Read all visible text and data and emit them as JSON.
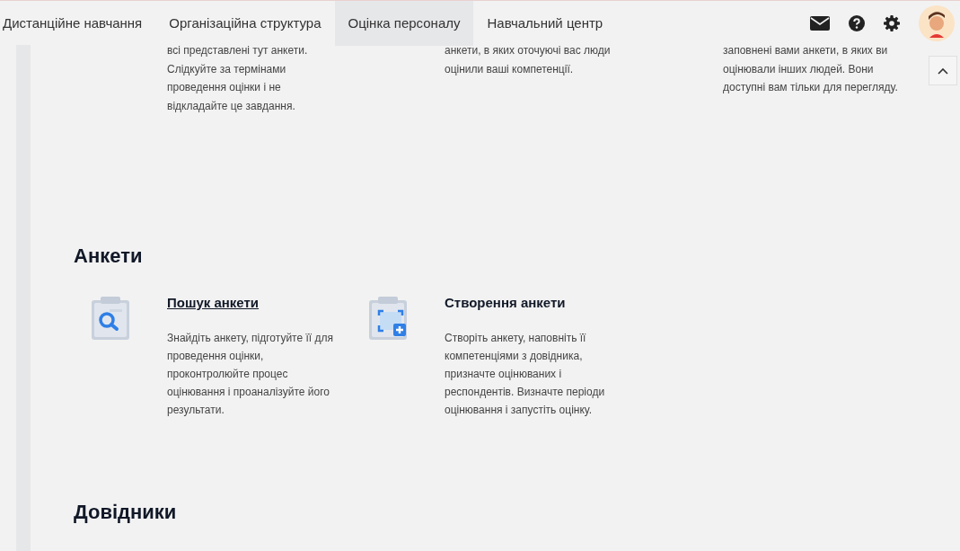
{
  "nav": {
    "tabs": [
      {
        "label": "Дистанційне навчання",
        "selected": false
      },
      {
        "label": "Організаційна структура",
        "selected": false
      },
      {
        "label": "Оцінка персоналу",
        "selected": true
      },
      {
        "label": "Навчальний центр",
        "selected": false
      }
    ]
  },
  "top_descriptions": [
    "всі представлені тут анкети. Слідкуйте за термінами проведення оцінки і не відкладайте це завдання.",
    "анкети, в яких оточуючі вас люди оцінили ваші компетенції.",
    "заповнені вами анкети, в яких ви оцінювали інших людей. Вони доступні вам тільки для перегляду."
  ],
  "sections": [
    {
      "title": "Анкети",
      "cards": [
        {
          "kind": "search",
          "title": "Пошук анкети",
          "link": true,
          "description": "Знайдіть анкету, підготуйте її для проведення оцінки, проконтролюйте процес оцінювання і проаналізуйте його результати."
        },
        {
          "kind": "create",
          "title": "Створення анкети",
          "link": false,
          "description": "Створіть анкету, наповніть її компетенціями з довідника, призначте оцінюваних і респондентів. Визначте періоди оцінювання і запустіть оцінку."
        }
      ]
    },
    {
      "title": "Довідники"
    }
  ]
}
